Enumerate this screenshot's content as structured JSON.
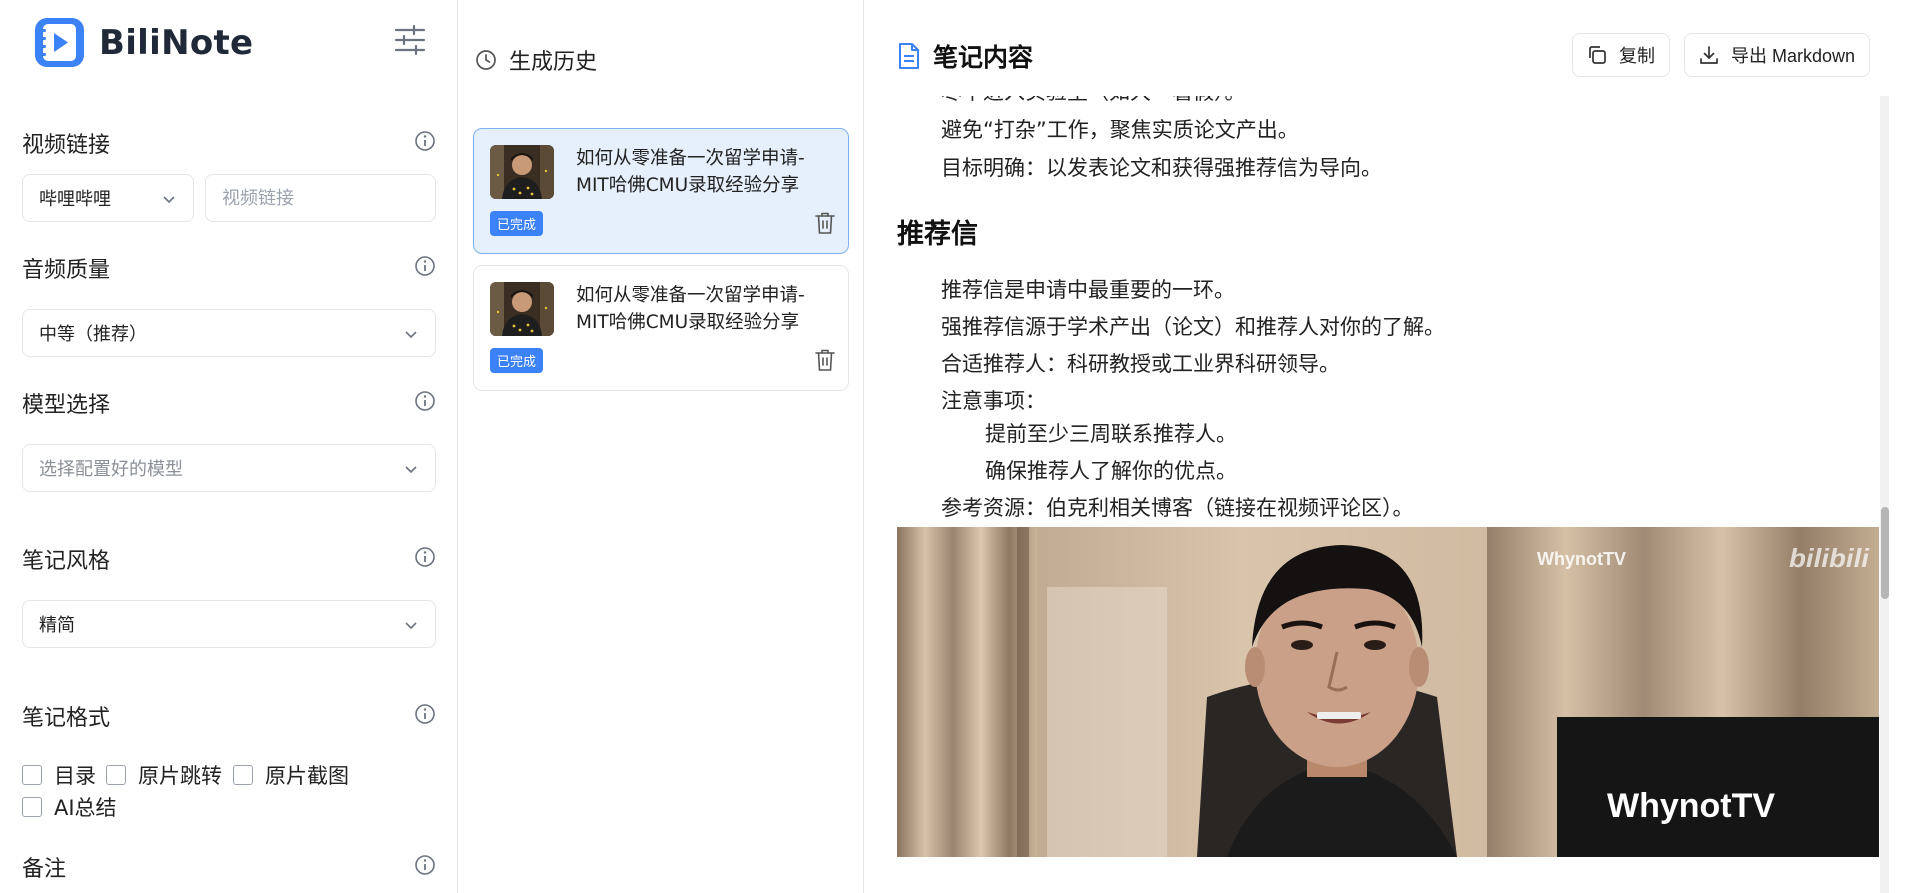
{
  "app": {
    "name": "BiliNote"
  },
  "left": {
    "video_link": {
      "label": "视频链接",
      "platform_selected": "哔哩哔哩",
      "url_placeholder": "视频链接"
    },
    "audio_quality": {
      "label": "音频质量",
      "selected": "中等（推荐）"
    },
    "model": {
      "label": "模型选择",
      "placeholder": "选择配置好的模型"
    },
    "note_style": {
      "label": "笔记风格",
      "selected": "精简"
    },
    "note_format": {
      "label": "笔记格式",
      "options": [
        "目录",
        "原片跳转",
        "原片截图",
        "AI总结"
      ]
    },
    "remarks": {
      "label": "备注"
    }
  },
  "history": {
    "title": "生成历史",
    "items": [
      {
        "title_line1": "如何从零准备一次留学申请-",
        "title_line2": "MIT哈佛CMU录取经验分享",
        "status": "已完成",
        "active": true
      },
      {
        "title_line1": "如何从零准备一次留学申请-",
        "title_line2": "MIT哈佛CMU录取经验分享",
        "status": "已完成",
        "active": false
      }
    ]
  },
  "note": {
    "title": "笔记内容",
    "copy_label": "复制",
    "export_label": "导出 Markdown",
    "content": {
      "partial_line": "尽早进入实验室（如大一暑假）。",
      "line_avoid": "避免“打杂”工作，聚焦实质论文产出。",
      "line_goal": "目标明确：以发表论文和获得强推荐信为导向。",
      "section_heading": "推荐信",
      "line_rec1": "推荐信是申请中最重要的一环。",
      "line_rec2": "强推荐信源于学术产出（论文）和推荐人对你的了解。",
      "line_rec3": "合适推荐人：科研教授或工业界科研领导。",
      "line_notes": "注意事项：",
      "line_note1": "提前至少三周联系推荐人。",
      "line_note2": "确保推荐人了解你的优点。",
      "line_ref": "参考资源：伯克利相关博客（链接在视频评论区）。"
    },
    "screenshot": {
      "watermark": "WhynotTV",
      "bili_mark": "bilibili",
      "monitor_text": "WhynotTV"
    }
  },
  "colors": {
    "accent": "#3b82f6",
    "active_card_bg": "#e6f0fd",
    "logo_blue": "#3b82f6"
  }
}
